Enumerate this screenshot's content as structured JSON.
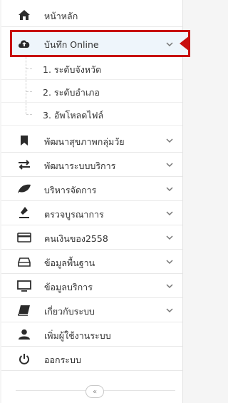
{
  "menu": {
    "home": {
      "label": "หน้าหลัก",
      "icon": "home-icon"
    },
    "record": {
      "label": "บันทึก Online",
      "icon": "cloud-upload-icon"
    },
    "submenu": [
      {
        "label": "1. ระดับจังหวัด"
      },
      {
        "label": "2. ระดับอำเภอ"
      },
      {
        "label": "3. อัพโหลดไฟล์"
      }
    ],
    "items": [
      {
        "label": "พัฒนาสุขภาพกลุ่มวัย",
        "icon": "bookmark-icon"
      },
      {
        "label": "พัฒนาระบบบริการ",
        "icon": "exchange-icon"
      },
      {
        "label": "บริหารจัดการ",
        "icon": "leaf-icon"
      },
      {
        "label": "ตรวจบูรณาการ",
        "icon": "pen-icon"
      },
      {
        "label": "คนเงินของ2558",
        "icon": "credit-card-icon"
      },
      {
        "label": "ข้อมูลพื้นฐาน",
        "icon": "drive-icon"
      },
      {
        "label": "ข้อมูลบริการ",
        "icon": "monitor-icon"
      },
      {
        "label": "เกี่ยวกับระบบ",
        "icon": "book-icon"
      },
      {
        "label": "เพิ่มผู้ใช้งานระบบ",
        "icon": "user-icon"
      },
      {
        "label": "ออกระบบ",
        "icon": "power-icon"
      }
    ],
    "collapse_label": "«"
  },
  "colors": {
    "highlight": "#c80f0f",
    "accent": "#2f80c2",
    "text": "#333333"
  }
}
